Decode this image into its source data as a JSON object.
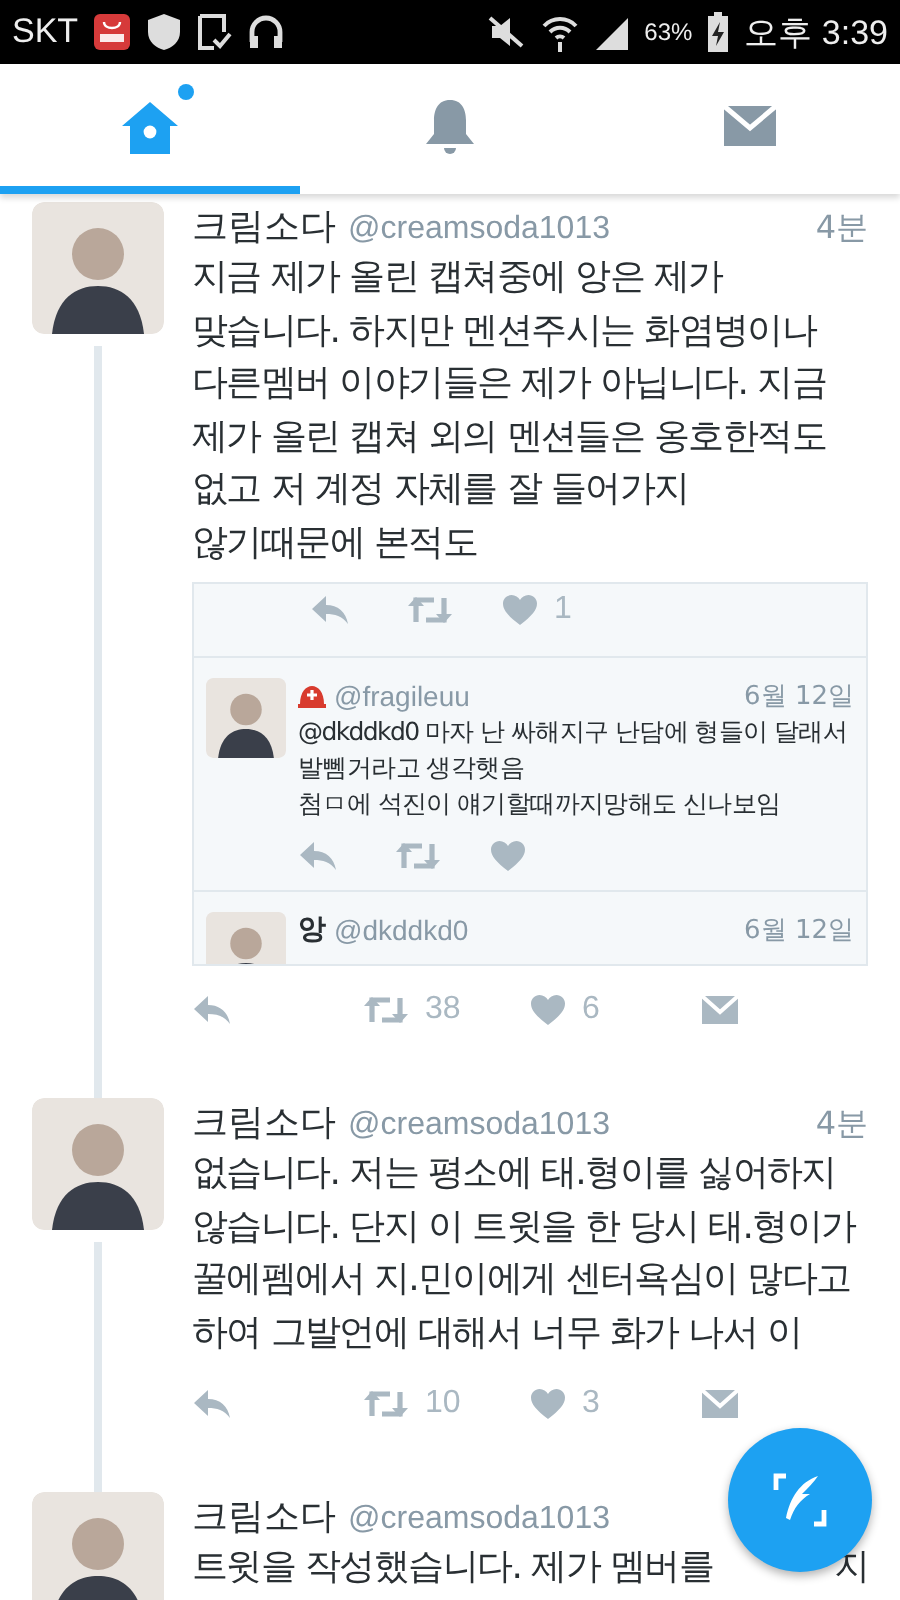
{
  "status_bar": {
    "carrier": "SKT",
    "battery": "63%",
    "time": "오후 3:39"
  },
  "tabs": [
    {
      "kind": "home",
      "selected": true,
      "dot": true
    },
    {
      "kind": "notifications",
      "selected": false,
      "dot": false
    },
    {
      "kind": "messages",
      "selected": false,
      "dot": false
    }
  ],
  "tweets": [
    {
      "name": "크림소다",
      "handle": "@creamsoda1013",
      "time": "4분",
      "text": "지금 제가 올린 캡쳐중에 앙은 제가\n맞습니다. 하지만 멘션주시는 화염병이나\n다른멤버 이야기들은 제가 아닙니다. 지금\n제가 올린 캡쳐 외의 멘션들은 옹호한적도\n없고 저 계정 자체를 잘 들어가지\n않기때문에 본적도",
      "thread": true,
      "conversation": {
        "top_likes": "1",
        "replies": [
          {
            "handle": "@fragileuu",
            "time": "6월 12일",
            "emoji": true,
            "text": "@dkddkd0 마자 난 싸해지구 난담에 형들이 달래서\n발뻼거라고 생각햇음\n첨ㅁ에 석진이 얘기할때까지망해도 신나보임",
            "actions": true
          },
          {
            "name": "앙",
            "handle": "@dkddkd0",
            "time": "6월 12일",
            "emoji": false,
            "actions": false
          }
        ]
      },
      "retweets": "38",
      "likes": "6"
    },
    {
      "name": "크림소다",
      "handle": "@creamsoda1013",
      "time": "4분",
      "text": "없습니다. 저는 평소에 태.형이를 싫어하지\n않습니다. 단지 이 트윗을 한 당시 태.형이가\n꿀에펨에서 지.민이에게 센터욕심이 많다고\n하여 그발언에 대해서 너무 화가 나서 이",
      "thread": true,
      "retweets": "10",
      "likes": "3"
    },
    {
      "name": "크림소다",
      "handle": "@creamsoda1013",
      "text": "트윗을 작성했습니다. 제가 멤버를",
      "text_tail": "지",
      "thread": false
    }
  ]
}
